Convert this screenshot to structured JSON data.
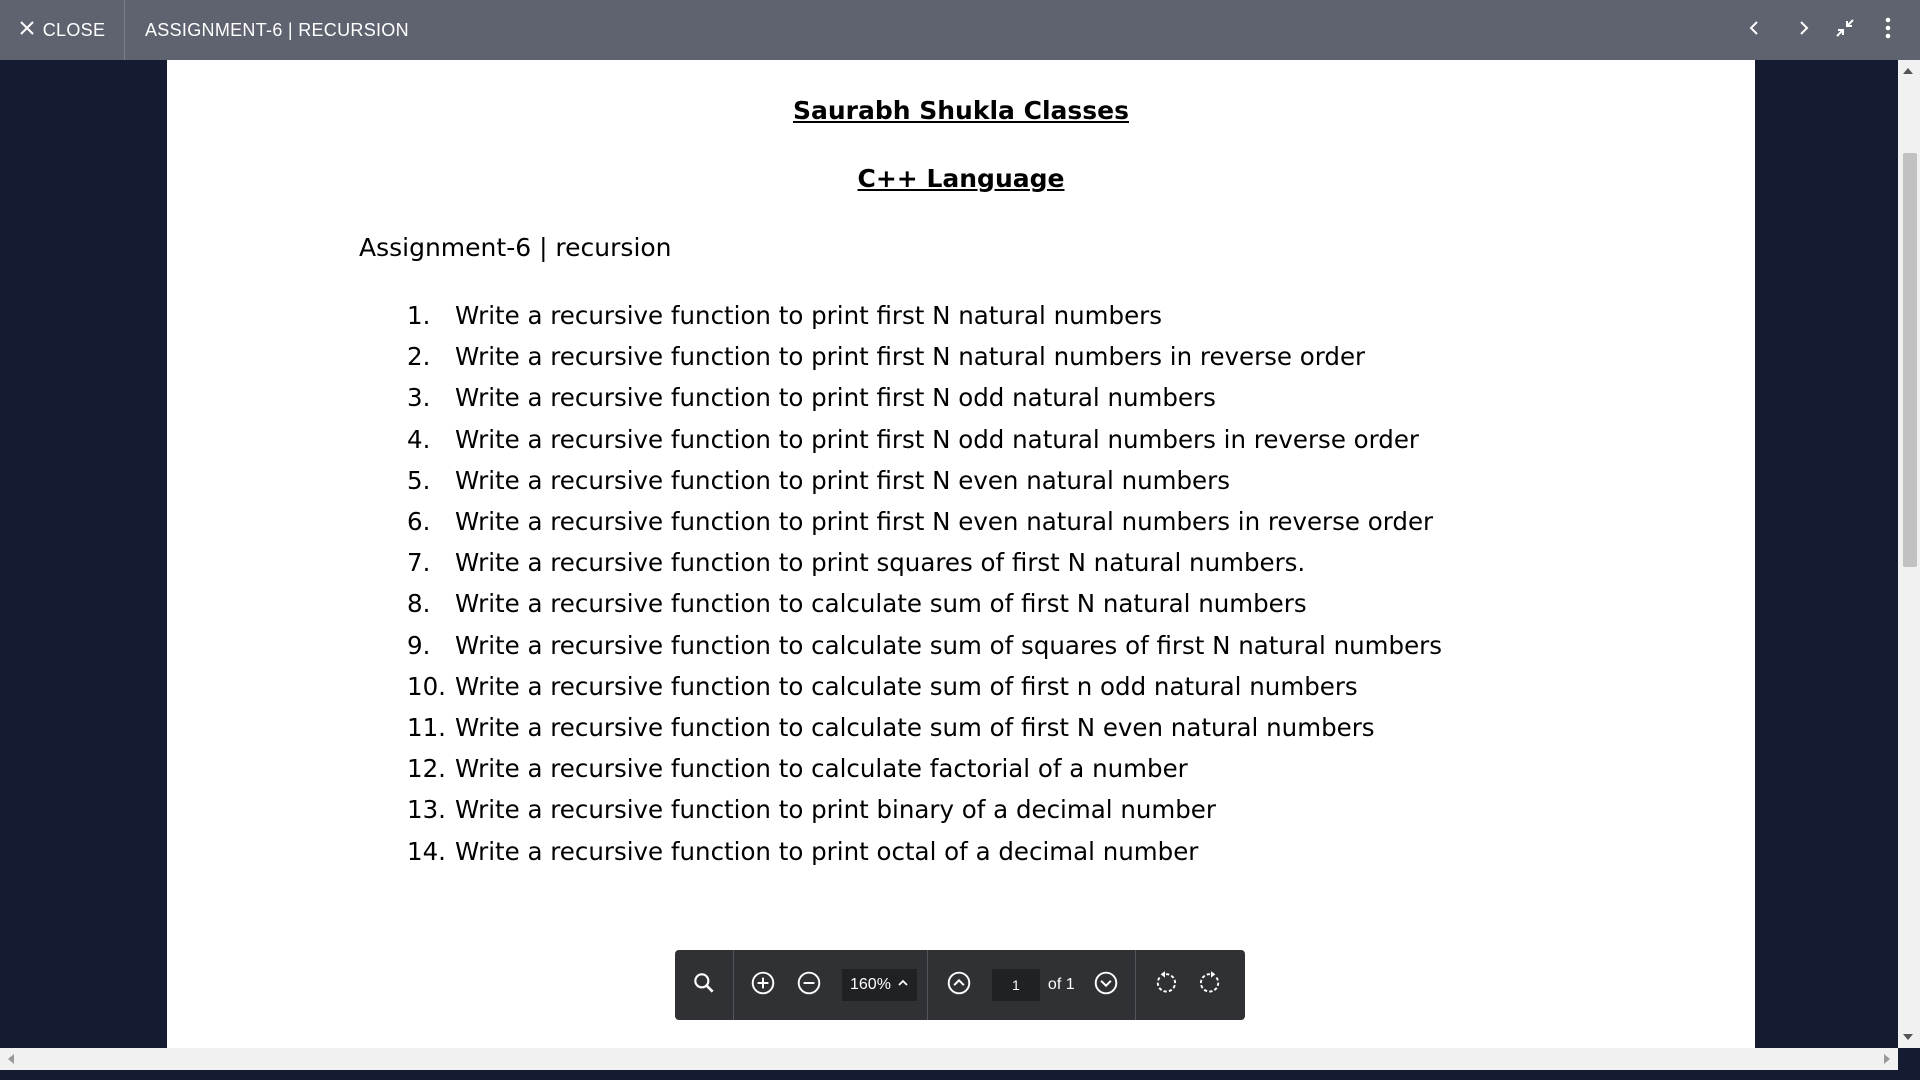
{
  "topbar": {
    "close_label": "CLOSE",
    "title": "ASSIGNMENT-6 | RECURSION",
    "icons": [
      "close-icon",
      "chevron-left-icon",
      "chevron-right-icon",
      "exit-fullscreen-icon",
      "more-vertical-icon"
    ]
  },
  "document": {
    "heading1": "Saurabh Shukla Classes",
    "heading2": "C++ Language",
    "assignment": "Assignment-6 | recursion",
    "items": [
      {
        "num": "1.",
        "text": "Write a recursive function to print first N natural numbers"
      },
      {
        "num": "2.",
        "text": "Write a recursive function to print first N natural numbers in reverse order"
      },
      {
        "num": "3.",
        "text": "Write a recursive function to print first N odd natural numbers"
      },
      {
        "num": "4.",
        "text": "Write a recursive function to print first N odd natural numbers in reverse order"
      },
      {
        "num": "5.",
        "text": "Write a recursive function to print first N even natural numbers"
      },
      {
        "num": "6.",
        "text": "Write a recursive function to print first N even natural numbers in reverse order"
      },
      {
        "num": "7.",
        "text": "Write a recursive function to print squares of first N natural numbers."
      },
      {
        "num": "8.",
        "text": "Write a recursive function to calculate sum of first N natural numbers"
      },
      {
        "num": "9.",
        "text": "Write a recursive function to calculate sum of squares of first N natural numbers"
      },
      {
        "num": "10.",
        "text": "Write a recursive function to calculate sum of first n odd natural numbers"
      },
      {
        "num": "11.",
        "text": "Write a recursive function to calculate sum of first N even natural numbers"
      },
      {
        "num": "12.",
        "text": "Write a recursive function to calculate factorial of a number"
      },
      {
        "num": "13.",
        "text": "Write a recursive function to print binary of a decimal number"
      },
      {
        "num": "14.",
        "text": "Write a recursive function to print octal of a decimal number"
      }
    ]
  },
  "toolbar": {
    "zoom": "160%",
    "page_value": "1",
    "of_label": "of 1",
    "icons": [
      "search-icon",
      "zoom-in-icon",
      "zoom-out-icon",
      "chevron-up-icon",
      "page-up-icon",
      "page-down-icon",
      "rotate-left-icon",
      "rotate-right-icon"
    ]
  },
  "colors": {
    "topbar": "#5f6370",
    "backdrop": "#151b30",
    "toolbar": "#303134"
  }
}
